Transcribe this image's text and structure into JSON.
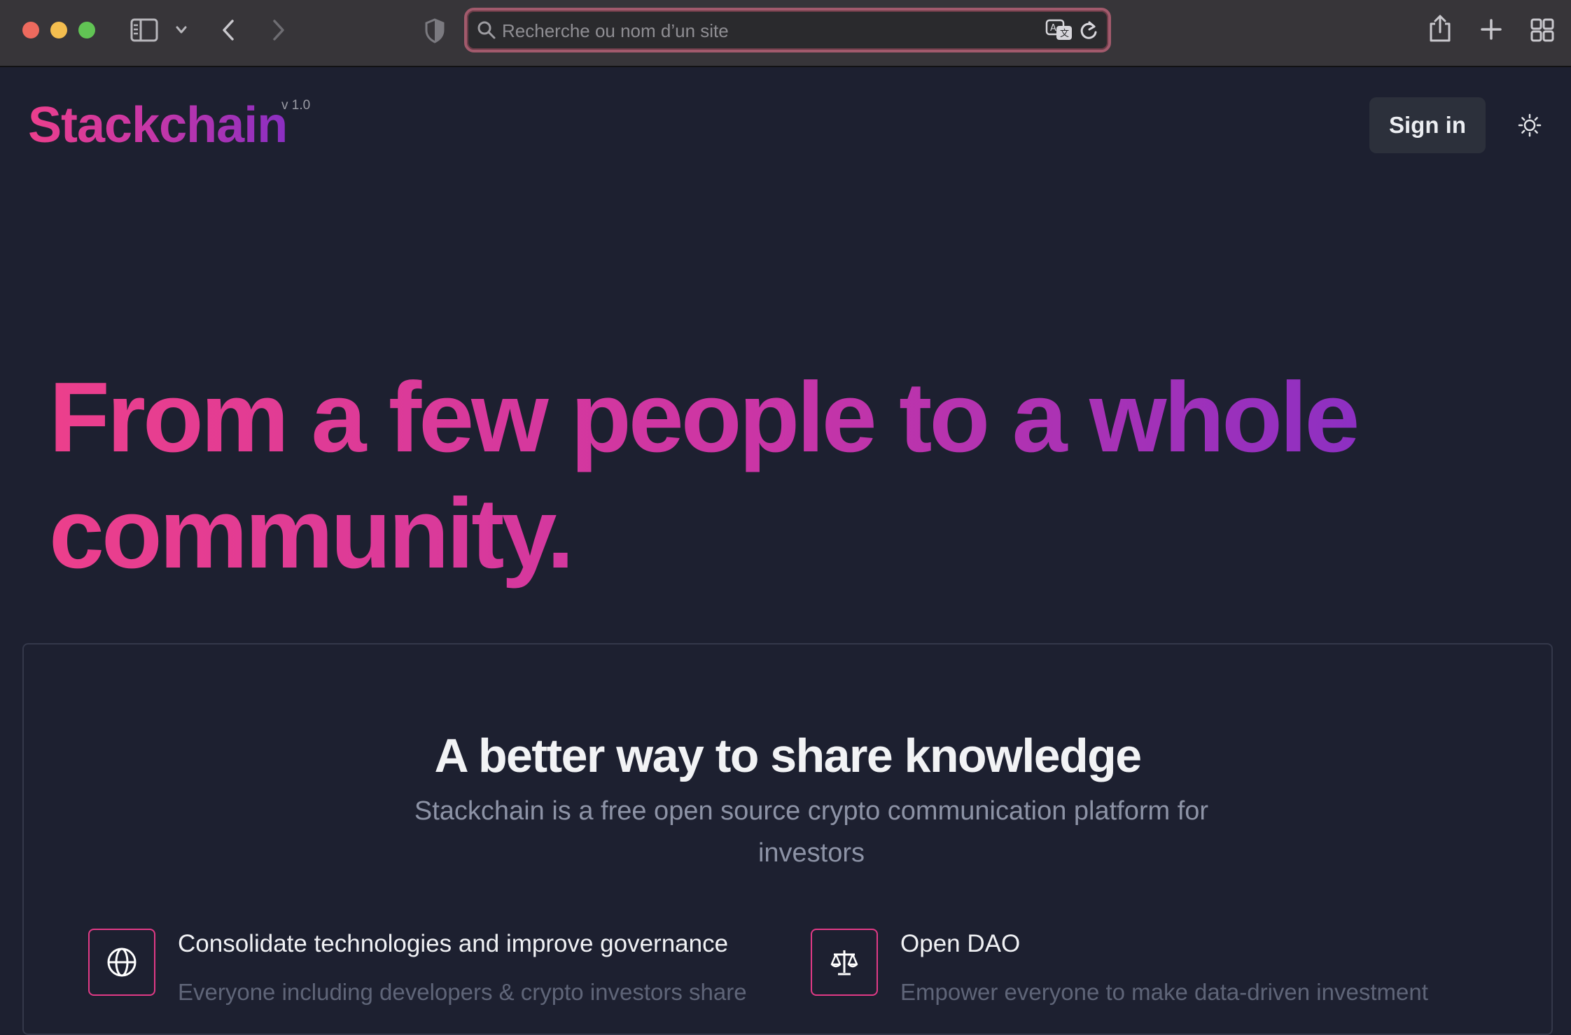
{
  "browser": {
    "address_placeholder": "Recherche ou nom d’un site",
    "icons": {
      "sidebar": "sidebar-icon",
      "dropdown": "chevron-down-icon",
      "back": "chevron-left-icon",
      "forward": "chevron-right-icon",
      "privacy": "shield-icon",
      "search": "search-icon",
      "translate": "translate-icon",
      "reload": "reload-icon",
      "share": "share-icon",
      "new_tab": "plus-icon",
      "tab_overview": "grid-icon"
    }
  },
  "header": {
    "brand": "Stackchain",
    "version": "v 1.0",
    "signin_label": "Sign in",
    "theme_icon": "sun-icon"
  },
  "hero": {
    "headline": "From a few people to a whole community."
  },
  "features_panel": {
    "title": "A better way to share knowledge",
    "subtitle": "Stackchain is a free open source crypto communication platform for investors",
    "features": [
      {
        "icon": "globe-icon",
        "title": "Consolidate technologies and improve governance",
        "description": "Everyone including developers & crypto investors share"
      },
      {
        "icon": "scale-icon",
        "title": "Open DAO",
        "description": "Empower everyone to make data-driven investment"
      }
    ]
  },
  "colors": {
    "page_background": "#1d2030",
    "brand_gradient_start": "#ec3f8c",
    "brand_gradient_end": "#8a2fc2",
    "feature_icon_border": "#e13a86",
    "chrome_background": "#373539",
    "urlbar_focus_ring": "#a25a6c"
  }
}
